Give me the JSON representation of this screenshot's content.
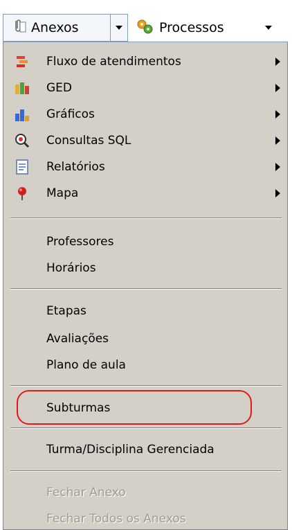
{
  "toolbar": {
    "anexos_label": "Anexos",
    "processos_label": "Processos"
  },
  "menu": {
    "submenu_items": [
      {
        "label": "Fluxo de atendimentos",
        "icon": "flow-icon"
      },
      {
        "label": "GED",
        "icon": "ged-icon"
      },
      {
        "label": "Gráficos",
        "icon": "chart-icon"
      },
      {
        "label": "Consultas SQL",
        "icon": "sql-query-icon"
      },
      {
        "label": "Relatórios",
        "icon": "report-icon"
      },
      {
        "label": "Mapa",
        "icon": "map-pin-icon"
      }
    ],
    "group1": [
      "Professores",
      "Horários"
    ],
    "group2": [
      "Etapas",
      "Avaliações",
      "Plano de aula"
    ],
    "group3": [
      "Subturmas"
    ],
    "group4": [
      "Turma/Disciplina Gerenciada"
    ],
    "disabled": [
      "Fechar Anexo",
      "Fechar Todos os Anexos"
    ]
  },
  "colors": {
    "menu_bg": "#d4d0c8",
    "highlight_ring": "#e01a1a",
    "disabled_text": "#a09c94"
  }
}
